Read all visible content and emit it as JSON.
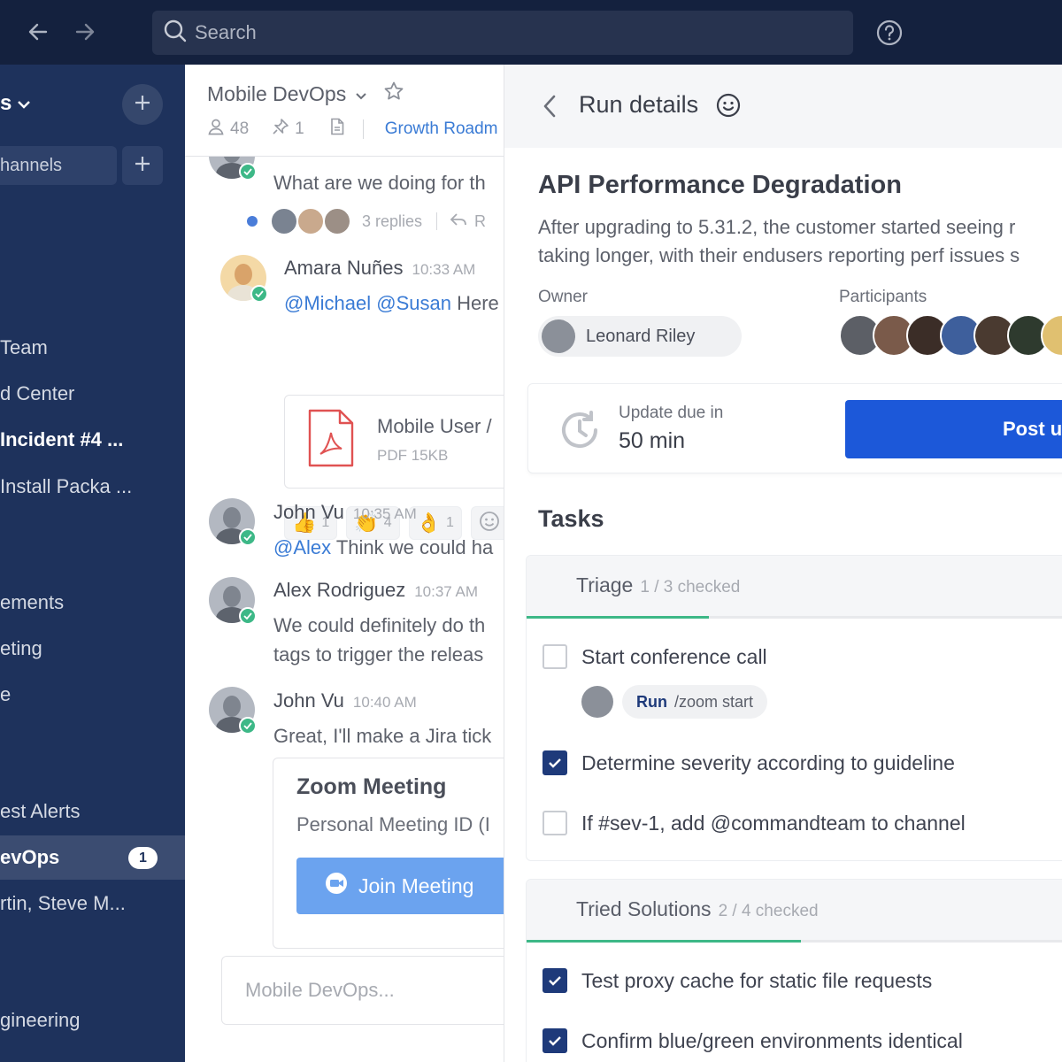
{
  "topbar": {
    "search_placeholder": "Search"
  },
  "sidebar": {
    "workspace": "s",
    "browse_label": "hannels",
    "items": [
      {
        "label": "Team",
        "style": "normal"
      },
      {
        "label": "d Center",
        "style": "normal"
      },
      {
        "label": "Incident #4 ...",
        "style": "bold"
      },
      {
        "label": "Install Packa ...",
        "style": "normal"
      },
      {
        "label": "ements",
        "style": "normal"
      },
      {
        "label": "eting",
        "style": "normal"
      },
      {
        "label": "e",
        "style": "normal"
      },
      {
        "label": "est Alerts",
        "style": "normal"
      },
      {
        "label": "evOps",
        "style": "active",
        "badge": "1"
      },
      {
        "label": "rtin, Steve M...",
        "style": "normal"
      },
      {
        "label": "gineering",
        "style": "normal"
      }
    ]
  },
  "channel": {
    "title": "Mobile DevOps",
    "members": "48",
    "pinned": "1",
    "bookmark": "Growth Roadm",
    "messages": {
      "m0": {
        "text": "What are we doing for th",
        "replies": "3 replies",
        "reply_action": "R"
      },
      "m1": {
        "author": "Amara Nuñes",
        "time": "10:33 AM",
        "mention1": "@Michael",
        "mention2": "@Susan",
        "text": "Here"
      },
      "file": {
        "name": "Mobile User /",
        "size": "PDF 15KB"
      },
      "reactions": [
        {
          "emoji": "👍",
          "count": "1"
        },
        {
          "emoji": "👏",
          "count": "4"
        },
        {
          "emoji": "👌",
          "count": "1"
        }
      ],
      "m2": {
        "author": "John Vu",
        "time": "10:35 AM",
        "mention": "@Alex",
        "text": "Think we could ha"
      },
      "m3": {
        "author": "Alex Rodriguez",
        "time": "10:37 AM",
        "line1": "We could definitely do th",
        "line2": "tags to trigger the releas"
      },
      "m4": {
        "author": "John Vu",
        "time": "10:40 AM",
        "text": "Great, I'll make a Jira tick"
      },
      "zoom": {
        "title": "Zoom Meeting",
        "id_text": "Personal Meeting ID (I",
        "button": "Join Meeting"
      }
    },
    "input_placeholder": "Mobile DevOps..."
  },
  "run": {
    "header_title": "Run details",
    "incident_title": "API Performance Degradation",
    "description_line1": "After upgrading to 5.31.2, the customer started seeing r",
    "description_line2": "taking longer, with their endusers reporting perf issues s",
    "owner_label": "Owner",
    "owner_name": "Leonard Riley",
    "participants_label": "Participants",
    "participant_colors": [
      "#5c5f66",
      "#7a5a4a",
      "#3b2d27",
      "#3e5f9c",
      "#4a3a30",
      "#2e3a2e",
      "#e0c070"
    ],
    "update_label": "Update due in",
    "update_value": "50 min",
    "post_button": "Post u",
    "tasks_heading": "Tasks",
    "checklists": [
      {
        "title": "Triage",
        "count": "1 / 3 checked",
        "progress": 0.333,
        "items": [
          {
            "label": "Start conference call",
            "checked": false,
            "command_label": "Run",
            "command": "/zoom start"
          },
          {
            "label": "Determine severity according to guideline",
            "checked": true
          },
          {
            "label": "If #sev-1, add @commandteam to channel",
            "checked": false
          }
        ]
      },
      {
        "title": "Tried Solutions",
        "count": "2 / 4 checked",
        "progress": 0.5,
        "items": [
          {
            "label": "Test proxy cache for static file requests",
            "checked": true
          },
          {
            "label": "Confirm blue/green environments identical",
            "checked": true
          }
        ]
      }
    ]
  },
  "colors": {
    "topbar": "#14213e",
    "sidebar": "#1e325c",
    "accent_blue": "#1c58d9",
    "online_green": "#3db887",
    "link_blue": "#3a7bd5"
  }
}
